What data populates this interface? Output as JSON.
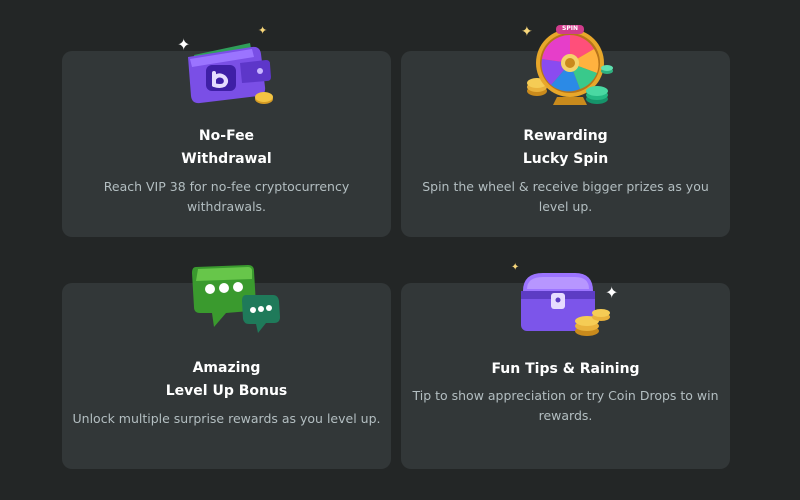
{
  "cards": [
    {
      "title_line1": "No-Fee",
      "title_line2": "Withdrawal",
      "description": "Reach VIP 38 for no-fee cryptocurrency withdrawals.",
      "icon": "wallet-icon"
    },
    {
      "title_line1": "Rewarding",
      "title_line2": "Lucky Spin",
      "description": "Spin the wheel & receive bigger prizes as you level up.",
      "icon": "spin-wheel-icon",
      "icon_text": "SPIN"
    },
    {
      "title_line1": "Amazing",
      "title_line2": "Level Up Bonus",
      "description": "Unlock multiple surprise rewards as you level up.",
      "icon": "chat-bubbles-icon"
    },
    {
      "title_line1": "Fun Tips & Raining",
      "description": "Tip to show appreciation or try Coin Drops to win rewards.",
      "icon": "treasure-chest-icon"
    }
  ],
  "colors": {
    "page_background": "#232626",
    "card_background": "#323738",
    "title_text": "#ffffff",
    "description_text": "#b3bec1"
  }
}
